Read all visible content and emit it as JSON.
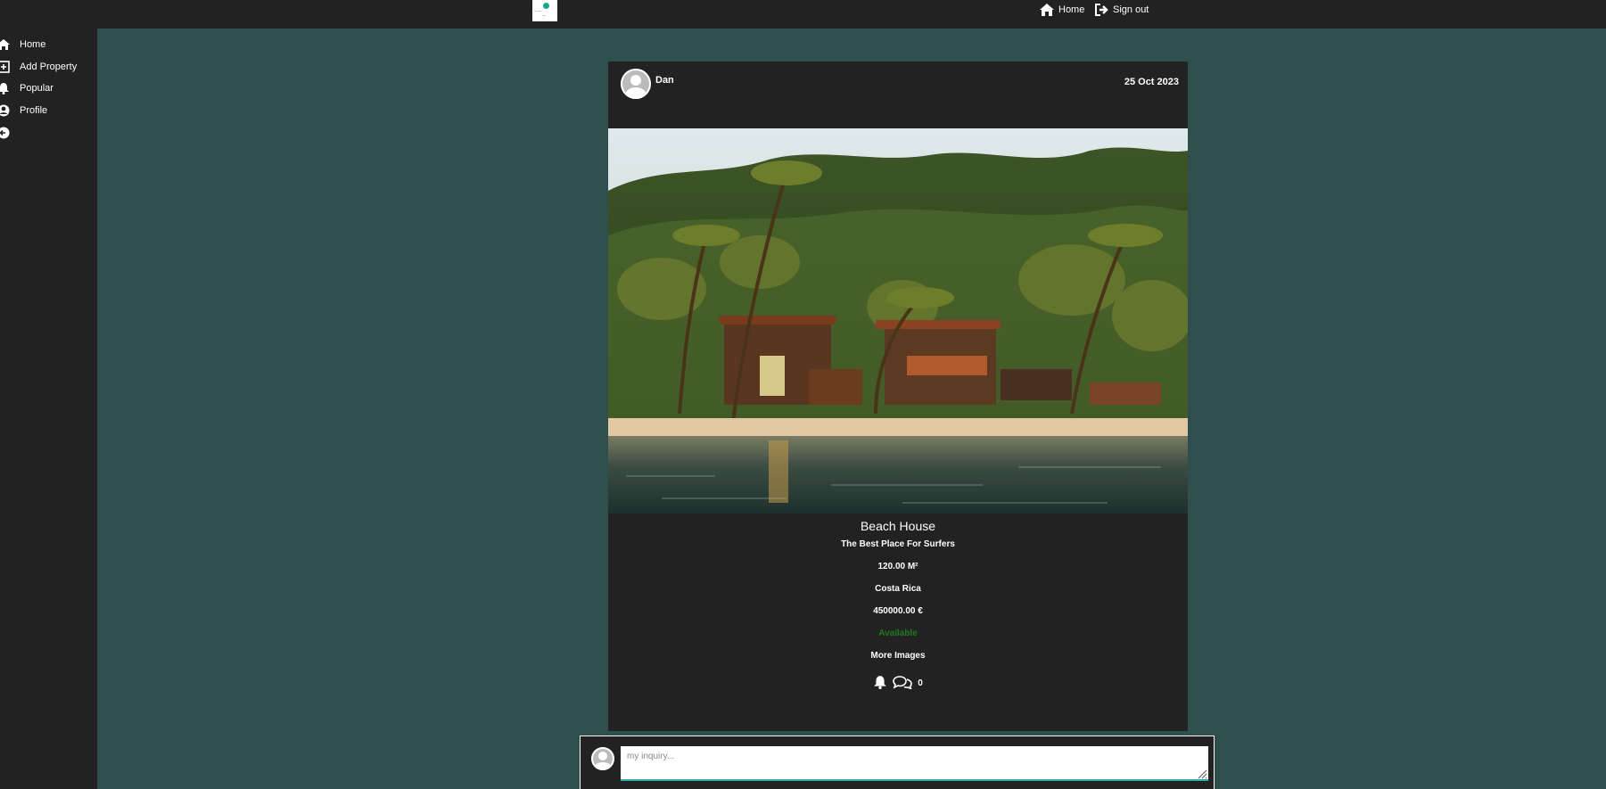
{
  "topbar": {
    "nav": [
      {
        "label": "Home",
        "icon": "home-icon"
      },
      {
        "label": "Sign out",
        "icon": "sign-out-icon"
      }
    ]
  },
  "sidebar": {
    "items": [
      {
        "label": "Home",
        "icon": "home-icon"
      },
      {
        "label": "Add Property",
        "icon": "plus-square-icon"
      },
      {
        "label": "Popular",
        "icon": "bell-icon"
      },
      {
        "label": "Profile",
        "icon": "user-circle-icon"
      },
      {
        "label": "",
        "icon": "arrow-left-circle-icon"
      }
    ]
  },
  "post": {
    "author": "Dan",
    "date": "25 Oct 2023",
    "title": "Beach House",
    "subtitle": "The Best Place For Surfers",
    "area": "120.00 M²",
    "location": "Costa Rica",
    "price": "450000.00 €",
    "status": "Available",
    "more_images": "More Images",
    "comment_count": "0"
  },
  "comment": {
    "placeholder": "my inquiry..."
  },
  "colors": {
    "background": "#2f4f4f",
    "panel": "#222222",
    "status_available": "#1f7a1f"
  }
}
